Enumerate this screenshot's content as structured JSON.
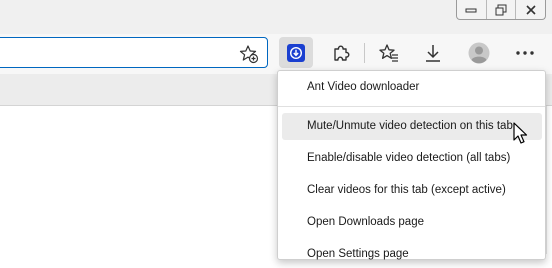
{
  "menu": {
    "title": "Ant Video downloader",
    "items": [
      {
        "label": "Mute/Unmute video detection on this tab"
      },
      {
        "label": "Enable/disable video detection (all tabs)"
      },
      {
        "label": "Clear videos for this tab (except active)"
      },
      {
        "label": "Open Downloads page"
      },
      {
        "label": "Open Settings page"
      }
    ]
  },
  "colors": {
    "accent": "#0067c0",
    "extension_icon": "#1a3fd0",
    "hover_background": "#ebebeb"
  },
  "icons": {
    "window_controls": [
      "minimize-icon",
      "restore-icon",
      "close-icon"
    ],
    "toolbar": [
      "add-favorite-icon",
      "ant-video-downloader-icon",
      "extensions-puzzle-icon",
      "favorites-icon",
      "downloads-icon",
      "profile-avatar-icon",
      "more-options-icon"
    ]
  }
}
